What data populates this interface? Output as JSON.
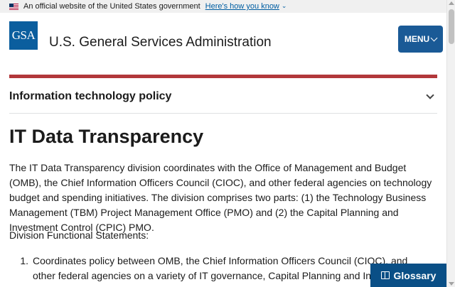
{
  "gov_banner": {
    "text": "An official website of the United States government",
    "link": "Here's how you know",
    "flag_icon": "us-flag-icon",
    "chevron_icon": "chevron-down-icon"
  },
  "header": {
    "logo": "GSA",
    "agency_name": "U.S. General Services Administration",
    "menu_label": "MENU",
    "menu_icon": "chevron-down-icon"
  },
  "section_nav": {
    "label": "Information technology policy",
    "icon": "chevron-down-icon"
  },
  "main": {
    "title": "IT Data Transparency",
    "intro": "The IT Data Transparency division coordinates with the Office of Management and Budget (OMB), the Chief Information Officers Council (CIOC), and other federal agencies on technology budget and spending initiatives. The division comprises two parts: (1) the Technology Business Management (TBM) Project Management Office (PMO)  and (2) the Capital Planning and Investment Control (CPIC) PMO.",
    "functional_heading": "Division Functional Statements:",
    "list": [
      {
        "num": "1.",
        "text": "Coordinates policy between OMB, the Chief Information Officers Council (CIOC), and other federal agencies on a variety of IT governance, Capital Planning and Investment Control (CPIC), and"
      }
    ]
  },
  "glossary": {
    "label": "Glossary",
    "icon": "book-icon"
  },
  "colors": {
    "brand_blue": "#0b5e9e",
    "menu_blue": "#1a5a96",
    "accent_red": "#b2373a",
    "link_blue": "#005ea2",
    "glossary_blue": "#0a4f86"
  }
}
